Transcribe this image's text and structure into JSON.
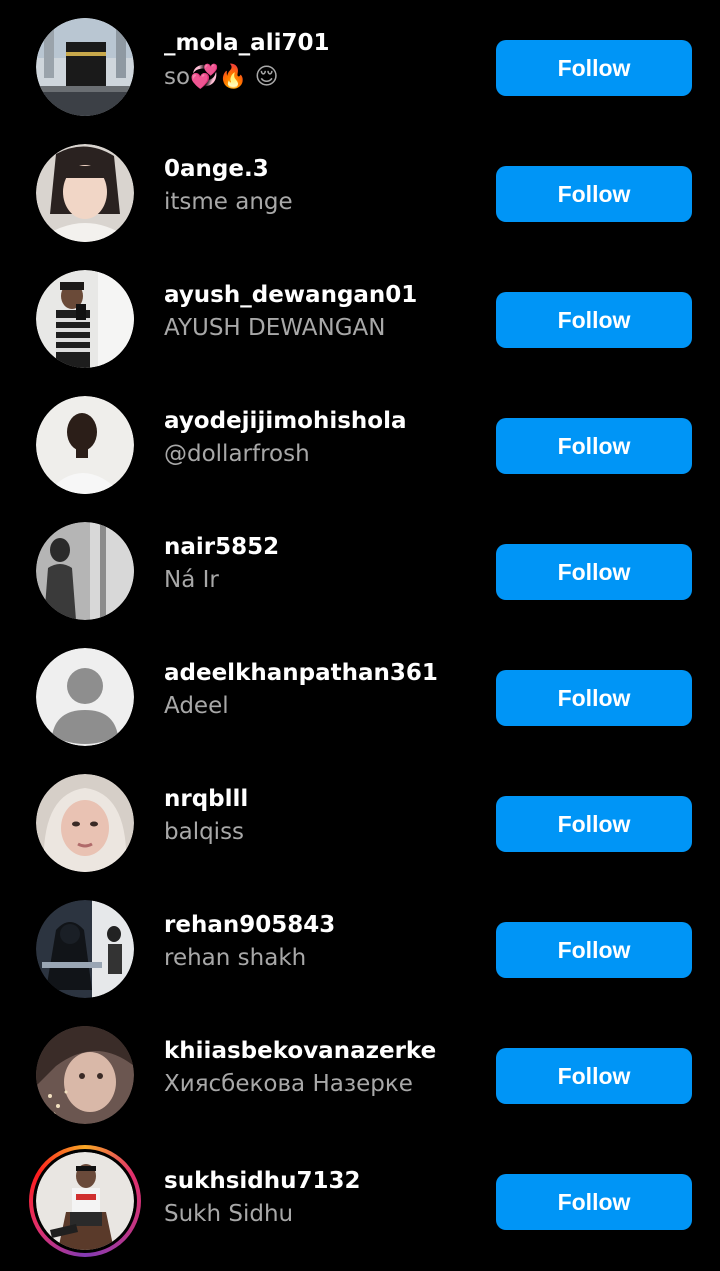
{
  "follow_label": "Follow",
  "colors": {
    "background": "#000000",
    "username": "#ffffff",
    "fullname": "#a8a8a8",
    "button": "#0095f6"
  },
  "users": [
    {
      "username": "_mola_ali701",
      "fullname": "so💞🔥 😌",
      "avatar": "kaaba-photo"
    },
    {
      "username": "0ange.3",
      "fullname": "itsme ange",
      "avatar": "selfie-photo"
    },
    {
      "username": "ayush_dewangan01",
      "fullname": "AYUSH DEWANGAN",
      "avatar": "mirror-selfie-photo"
    },
    {
      "username": "ayodejijimohishola",
      "fullname": "@dollarfrosh",
      "avatar": "portrait-photo"
    },
    {
      "username": "nair5852",
      "fullname": "Ná Ir",
      "avatar": "bw-mirror-photo"
    },
    {
      "username": "adeelkhanpathan361",
      "fullname": "Adeel",
      "avatar": "default-avatar-icon"
    },
    {
      "username": "nrqblll",
      "fullname": "balqiss",
      "avatar": "hijab-selfie-photo"
    },
    {
      "username": "rehan905843",
      "fullname": "rehan shakh",
      "avatar": "anime-art-photo"
    },
    {
      "username": "khiiasbekovanazerke",
      "fullname": "Хиясбекова Назерке",
      "avatar": "sparkle-selfie-photo"
    },
    {
      "username": "sukhsidhu7132",
      "fullname": "Sukh Sidhu",
      "avatar": "chair-pose-photo",
      "story_ring": true
    }
  ]
}
